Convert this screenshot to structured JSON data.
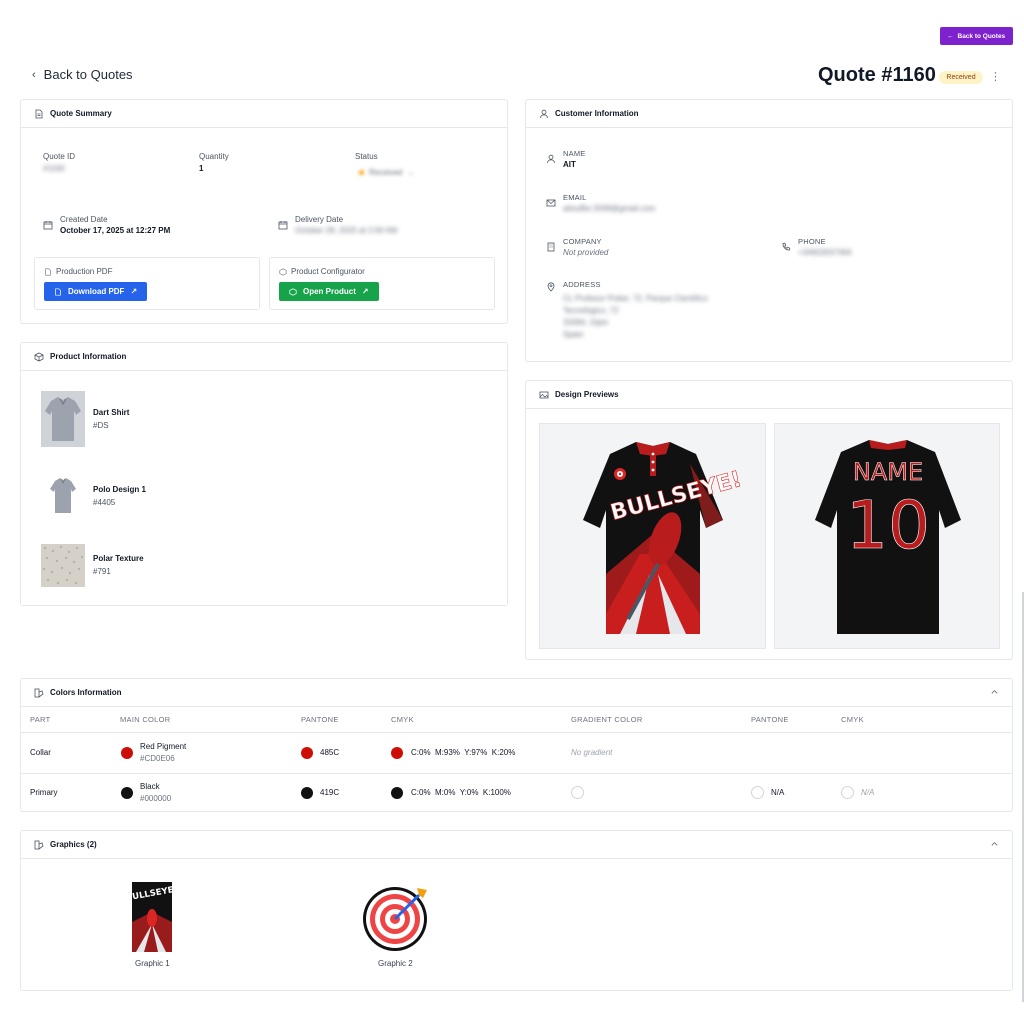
{
  "header": {
    "back_link": "Back to Quotes",
    "back_button": "Back to Quotes",
    "quote_title": "Quote #1160",
    "status_badge": "Received"
  },
  "colors": {
    "purple": "#7e22ce",
    "blue": "#2563eb",
    "green": "#16a34a",
    "badge_bg": "#fef3c7",
    "badge_text": "#92400e"
  },
  "quote_summary": {
    "title": "Quote Summary",
    "quote_id_label": "Quote ID",
    "quote_id_value": "#1160",
    "quantity_label": "Quantity",
    "quantity_value": "1",
    "status_label": "Status",
    "status_value": "Received",
    "created_label": "Created Date",
    "created_value": "October 17, 2025 at 12:27 PM",
    "delivery_label": "Delivery Date",
    "delivery_value": "October 28, 2025 at 2:00 AM",
    "production_pdf_label": "Production PDF",
    "download_button": "Download PDF",
    "configurator_label": "Product Configurator",
    "open_button": "Open Product"
  },
  "customer": {
    "title": "Customer Information",
    "name_label": "NAME",
    "name_value": "AIT",
    "email_label": "EMAIL",
    "email_value": "aitsuffer.2008@gmail.com",
    "company_label": "COMPANY",
    "company_value": "Not provided",
    "phone_label": "PHONE",
    "phone_value": "+34602637464",
    "address_label": "ADDRESS",
    "address_lines": [
      "CL Profesor Potter, 72, Parque Científico",
      "Tecnológico, 72",
      "33394, Gijón",
      "Spain"
    ]
  },
  "product_info": {
    "title": "Product Information",
    "items": [
      {
        "name": "Dart Shirt",
        "code": "#DS"
      },
      {
        "name": "Polo Design 1",
        "code": "#4405"
      },
      {
        "name": "Polar Texture",
        "code": "#791"
      }
    ]
  },
  "design_previews": {
    "title": "Design Previews",
    "front_text": "BULLSEYE!",
    "back_name": "NAME",
    "back_number": "10"
  },
  "colors_info": {
    "title": "Colors Information",
    "headers": [
      "PART",
      "MAIN COLOR",
      "PANTONE",
      "CMYK",
      "GRADIENT COLOR",
      "PANTONE",
      "CMYK"
    ],
    "rows": [
      {
        "part": "Collar",
        "main_name": "Red Pigment",
        "main_hex": "#CD0E06",
        "main_color": "#cd0e06",
        "pantone": "485C",
        "cmyk": "C:0%  M:93%  Y:97%  K:20%",
        "gradient": "No gradient"
      },
      {
        "part": "Primary",
        "main_name": "Black",
        "main_hex": "#000000",
        "main_color": "#111111",
        "pantone": "419C",
        "cmyk": "C:0%  M:0%  Y:0%  K:100%",
        "gradient_pantone": "N/A",
        "gradient_cmyk": "N/A"
      }
    ]
  },
  "graphics": {
    "title": "Graphics (2)",
    "items": [
      {
        "label": "Graphic 1",
        "text": "BULLSEYE!"
      },
      {
        "label": "Graphic 2"
      }
    ]
  }
}
